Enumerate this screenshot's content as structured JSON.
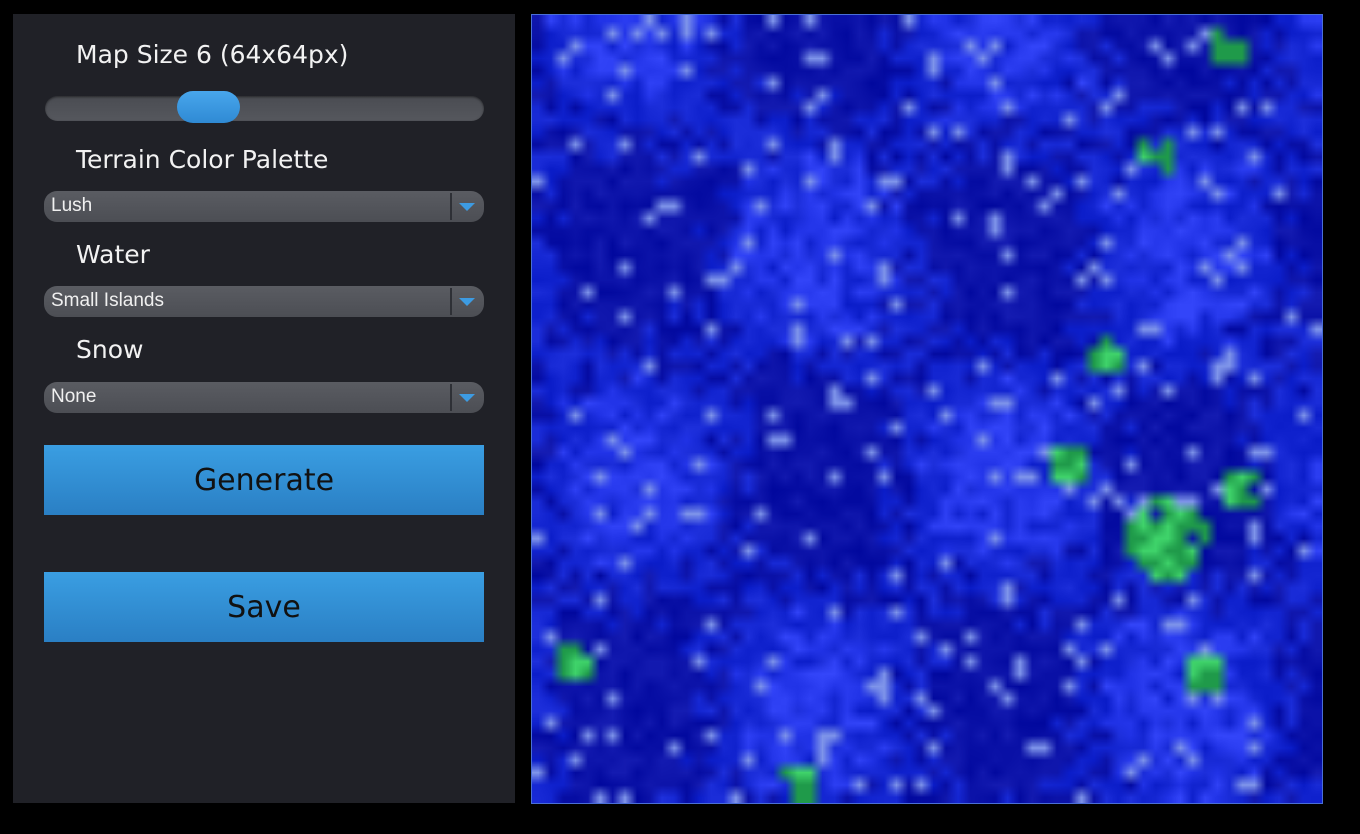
{
  "sidebar": {
    "map_size_label": "Map Size 6 (64x64px)",
    "map_size_slider": {
      "value": 6,
      "min": 1,
      "max": 15,
      "fraction": 0.35
    },
    "palette_label": "Terrain Color Palette",
    "palette_value": "Lush",
    "water_label": "Water",
    "water_value": "Small Islands",
    "snow_label": "Snow",
    "snow_value": "None",
    "generate_label": "Generate",
    "save_label": "Save"
  },
  "map": {
    "grid_size": 64,
    "colors": {
      "deep_water": "#0b12a8",
      "water": "#1426d2",
      "shallow": "#2a3cf0",
      "sparkle": "#7f95ea",
      "land": "#3fd36a",
      "land_dark": "#1f9a4a"
    }
  },
  "colors": {
    "panel_bg": "#202127",
    "accent": "#3a9ee2",
    "page_bg": "#000000"
  }
}
